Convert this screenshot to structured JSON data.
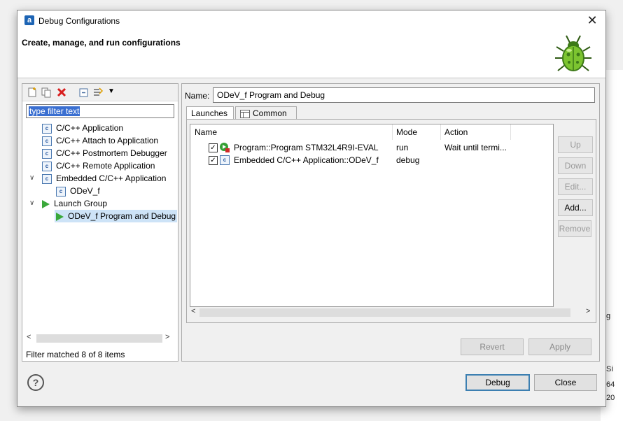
{
  "window": {
    "title": "Debug Configurations",
    "app_icon_letter": "a"
  },
  "header": {
    "title": "Create, manage, and run configurations"
  },
  "left": {
    "toolbar": [
      "new-configuration-icon",
      "duplicate-icon",
      "delete-icon",
      "collapse-all-icon",
      "filter-icon",
      "dropdown-icon"
    ],
    "filter_placeholder": "type filter text",
    "tree": [
      {
        "label": "C/C++ Application"
      },
      {
        "label": "C/C++ Attach to Application"
      },
      {
        "label": "C/C++ Postmortem Debugger"
      },
      {
        "label": "C/C++ Remote Application"
      },
      {
        "label": "Embedded C/C++ Application"
      },
      {
        "label": "ODeV_f"
      },
      {
        "label": "Launch Group"
      },
      {
        "label": "ODeV_f Program and Debug"
      }
    ],
    "status": "Filter matched 8 of 8 items"
  },
  "right": {
    "name_label": "Name:",
    "name_value": "ODeV_f Program and Debug",
    "tabs": [
      {
        "label": "Launches"
      },
      {
        "label": "Common"
      }
    ],
    "table": {
      "columns": [
        "Name",
        "Mode",
        "Action"
      ],
      "rows": [
        {
          "name": "Program::Program STM32L4R9I-EVAL",
          "mode": "run",
          "action": "Wait until termi..."
        },
        {
          "name": "Embedded C/C++ Application::ODeV_f",
          "mode": "debug",
          "action": ""
        }
      ]
    },
    "side_buttons": {
      "up": "Up",
      "down": "Down",
      "edit": "Edit...",
      "add": "Add...",
      "remove": "Remove"
    },
    "revert": "Revert",
    "apply": "Apply"
  },
  "footer": {
    "help": "?",
    "debug": "Debug",
    "close": "Close"
  },
  "background": {
    "t1": "Si",
    "t2": "64",
    "t3": "20",
    "t4": "g"
  }
}
